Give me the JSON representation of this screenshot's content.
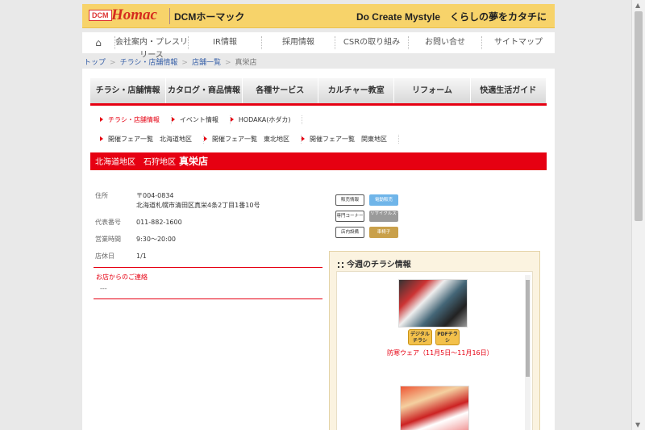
{
  "header": {
    "logo_badge": "DCM",
    "logo_brand": "Homac",
    "logo_sub": "DCMホーマック",
    "tagline": "Do Create Mystyle　くらしの夢をカタチに"
  },
  "global_nav": {
    "home_icon": "home-icon",
    "items": [
      "会社案内・プレスリリース",
      "IR情報",
      "採用情報",
      "CSRの取り組み",
      "お問い合せ",
      "サイトマップ"
    ]
  },
  "breadcrumb": {
    "items": [
      "トップ",
      "チラシ・店舗情報",
      "店舗一覧"
    ],
    "current": "真栄店",
    "separator": ">"
  },
  "main_nav": [
    "チラシ・店舗情報",
    "カタログ・商品情報",
    "各種サービス",
    "カルチャー教室",
    "リフォーム",
    "快適生活ガイド"
  ],
  "sub_nav_1": [
    "チラシ・店舗情報",
    "イベント情報",
    "HODAKA(ホダカ)"
  ],
  "sub_nav_2": [
    "開催フェア一覧　北海道地区",
    "開催フェア一覧　東北地区",
    "開催フェア一覧　関東地区"
  ],
  "store_header": {
    "region": "北海道地区　石狩地区",
    "name": "真栄店"
  },
  "store_info": {
    "address_label": "住所",
    "postal": "〒004-0834",
    "address": "北海道札幌市清田区真栄4条2丁目1番10号",
    "phone_label": "代表番号",
    "phone": "011-882-1600",
    "hours_label": "営業時間",
    "hours": "9:30〜20:00",
    "holiday_label": "店休日",
    "holiday": "1/1"
  },
  "contact": {
    "title": "お店からのご連絡",
    "text": "---"
  },
  "badges": {
    "row1": [
      "販売情報",
      "電動販売"
    ],
    "row2": [
      "専門コーナー",
      "リサイクルステーション"
    ],
    "row3": [
      "店内設備",
      "車椅子"
    ]
  },
  "flyer": {
    "title": "今週のチラシ情報",
    "digital_btn": "デジタルチラシ",
    "pdf_btn": "PDFチラシ",
    "caption": "防寒ウェア（11月5日〜11月16日）"
  },
  "colors": {
    "accent_red": "#e60012",
    "header_yellow": "#f7d36a",
    "link_blue": "#3a62a9"
  }
}
